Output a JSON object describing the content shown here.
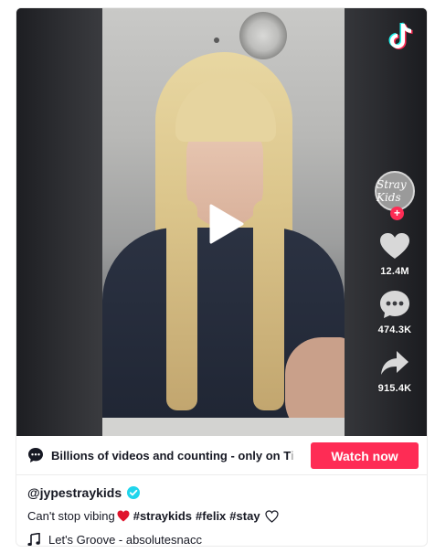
{
  "video": {
    "play_icon": "play-icon",
    "logo_icon": "tiktok-logo-icon"
  },
  "sidebar": {
    "avatar_text": "Stray Kids",
    "follow_symbol": "+",
    "likes": "12.4M",
    "comments": "474.3K",
    "shares": "915.4K"
  },
  "banner": {
    "tagline": "Billions of videos and counting - only on T",
    "tagline_fade": "i",
    "watch_label": "Watch now"
  },
  "post": {
    "username": "@jypestraykids",
    "caption_text": "Can't stop vibing",
    "hashtags": [
      "#straykids",
      "#felix",
      "#stay"
    ],
    "music": "Let's Groove - absolutesnacc"
  },
  "colors": {
    "accent": "#fe2c55",
    "verified": "#20d5ec",
    "text": "#161823"
  }
}
